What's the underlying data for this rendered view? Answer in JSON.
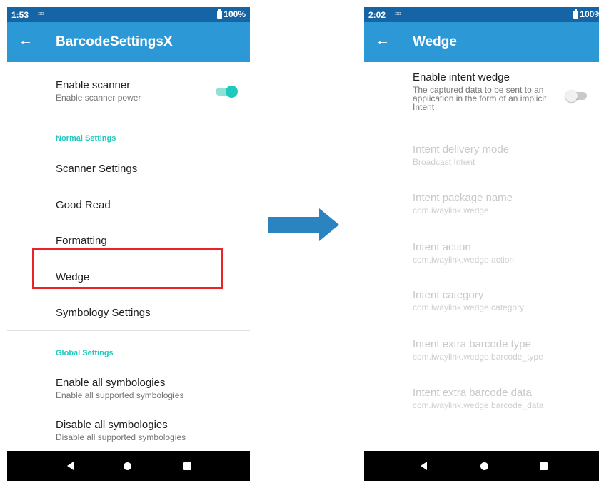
{
  "left": {
    "status": {
      "time": "1:53",
      "scan_glyph": "⌗⌗",
      "battery": "100%"
    },
    "appbar": {
      "back": "←",
      "title": "BarcodeSettingsX"
    },
    "enable_scanner": {
      "title": "Enable scanner",
      "summary": "Enable scanner power",
      "checked": true
    },
    "normal_settings": {
      "header": "Normal Settings",
      "items": [
        "Scanner Settings",
        "Good Read",
        "Formatting",
        "Wedge",
        "Symbology Settings"
      ]
    },
    "global_settings": {
      "header": "Global Settings",
      "items": [
        {
          "title": "Enable all symbologies",
          "summary": "Enable all supported symbologies"
        },
        {
          "title": "Disable all symbologies",
          "summary": "Disable all supported symbologies"
        }
      ]
    }
  },
  "right": {
    "status": {
      "time": "2:02",
      "scan_glyph": "⌗⌗",
      "battery": "100%"
    },
    "appbar": {
      "back": "←",
      "title": "Wedge"
    },
    "enable_intent": {
      "title": "Enable intent wedge",
      "summary": "The captured data to be sent to an application in the form of an implicit Intent",
      "checked": false
    },
    "items": [
      {
        "title": "Intent delivery mode",
        "summary": "Broadcast Intent"
      },
      {
        "title": "Intent package name",
        "summary": "com.iwaylink.wedge"
      },
      {
        "title": "Intent action",
        "summary": "com.iwaylink.wedge.action"
      },
      {
        "title": "Intent category",
        "summary": "com.iwaylink.wedge.category"
      },
      {
        "title": "Intent extra barcode type",
        "summary": "com.iwaylink.wedge.barcode_type"
      },
      {
        "title": "Intent extra barcode data",
        "summary": "com.iwaylink.wedge.barcode_data"
      }
    ]
  },
  "colors": {
    "status_bar": "#1565a6",
    "app_bar": "#2d98d6",
    "accent": "#1fc9bd",
    "highlight": "#e8232a",
    "arrow": "#2b83bf"
  },
  "icons": {
    "back": "arrow-left-icon",
    "nav_back": "triangle-back-icon",
    "nav_home": "circle-home-icon",
    "nav_recent": "square-recent-icon",
    "transition": "arrow-right-icon"
  }
}
